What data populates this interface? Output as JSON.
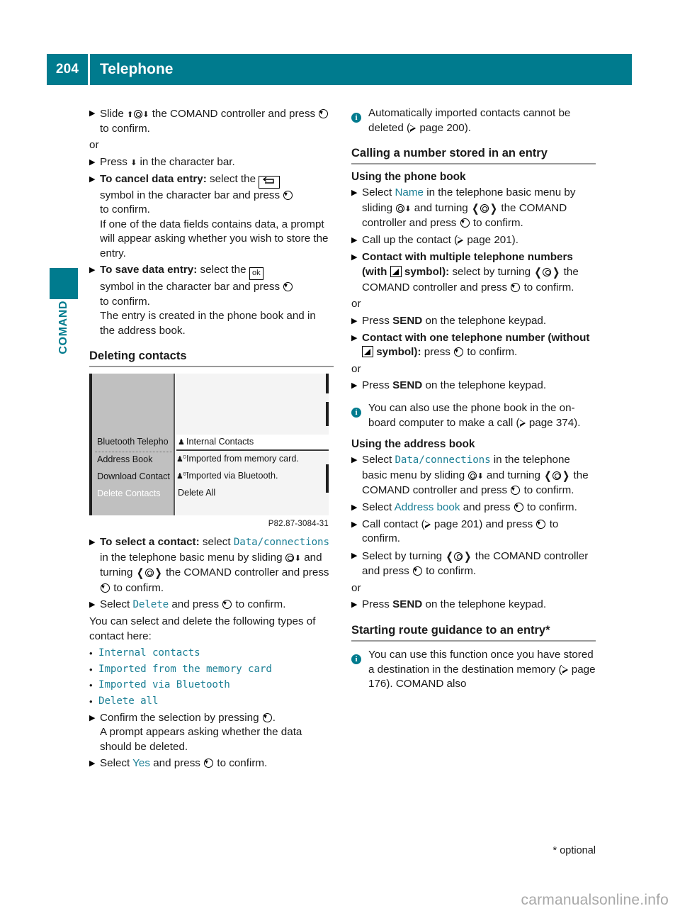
{
  "header": {
    "page_number": "204",
    "title": "Telephone"
  },
  "sidebar": {
    "tab_label": "COMAND"
  },
  "left_column": {
    "steps": [
      {
        "id": "slide-confirm",
        "parts": [
          "Slide ",
          "⬆◎⬇",
          " the COMAND controller and press ",
          "◎",
          " to confirm."
        ],
        "text": "Slide the COMAND controller and press to confirm."
      }
    ],
    "step1_pre": "Slide",
    "step1_mid": "the COMAND controller and",
    "step1_end": "press",
    "step1_tail": "to confirm.",
    "or_1": "or",
    "step2_pre": "Press",
    "step2_post": "in the character bar.",
    "step3_bold": "To cancel data entry:",
    "step3_a": "select the",
    "step3_b": "symbol in the character bar and press",
    "step3_c": "to confirm.",
    "step3_note": "If one of the data fields contains data, a prompt will appear asking whether you wish to store the entry.",
    "step4_bold": "To save data entry:",
    "step4_a": "select the",
    "step4_ok": "ok",
    "step4_b": "symbol in the character bar and press",
    "step4_c": "to confirm.",
    "step4_note": "The entry is created in the phone book and in the address book.",
    "heading_deleting": "Deleting contacts",
    "figure": {
      "caption": "P82.87-3084-31",
      "left_menu": [
        "Bluetooth Telepho",
        "Address Book",
        "Download Contact",
        "Delete Contacts"
      ],
      "left_menu_selected": "Delete Contacts",
      "right_menu": [
        {
          "label": "Internal Contacts",
          "icon": "contact-icon"
        },
        {
          "label": "Imported from memory card.",
          "icon": "contact-sd-icon"
        },
        {
          "label": "Imported via Bluetooth.",
          "icon": "contact-bt-icon"
        },
        {
          "label": "Delete All",
          "icon": ""
        }
      ]
    },
    "step5_bold": "To select a contact:",
    "step5_a": "select",
    "step5_mono": "Data/connections",
    "step5_b": "in the telephone basic menu by sliding",
    "step5_c": "and turning",
    "step5_d": "the COMAND controller and press",
    "step5_e": "to confirm.",
    "step6_a": "Select",
    "step6_mono": "Delete",
    "step6_b": "and press",
    "step6_c": "to confirm.",
    "para_types": "You can select and delete the following types of contact here:",
    "contact_types": [
      "Internal contacts",
      "Imported from the memory card",
      "Imported via Bluetooth",
      "Delete all"
    ],
    "step7_a": "Confirm the selection by pressing",
    "step7_b": ".",
    "step7_note": "A prompt appears asking whether the data should be deleted.",
    "step8_a": "Select",
    "step8_mono": "Yes",
    "step8_b": "and press",
    "step8_c": "to confirm."
  },
  "right_column": {
    "note1_a": "Automatically imported contacts cannot be deleted (",
    "note1_page": "page 200",
    "note1_b": ").",
    "heading_calling": "Calling a number stored in an entry",
    "subheading_phonebook": "Using the phone book",
    "r1_a": "Select",
    "r1_mono": "Name",
    "r1_b": "in the telephone basic menu by sliding",
    "r1_c": "and turning",
    "r1_d": "the COMAND controller and press",
    "r1_e": "to confirm.",
    "r2_a": "Call up the contact (",
    "r2_page": "page 201",
    "r2_b": ").",
    "r3_bold_a": "Contact with multiple telephone numbers (with",
    "r3_bold_b": "symbol):",
    "r3_a": "select by turning",
    "r3_b": "the COMAND controller and press",
    "r3_c": "to confirm.",
    "or_2": "or",
    "r4_a": "Press",
    "r4_bold": "SEND",
    "r4_b": "on the telephone keypad.",
    "r5_bold_a": "Contact with one telephone number (without",
    "r5_bold_b": "symbol):",
    "r5_a": "press",
    "r5_b": "to confirm.",
    "or_3": "or",
    "r6_a": "Press",
    "r6_bold": "SEND",
    "r6_b": "on the telephone keypad.",
    "note2_a": "You can also use the phone book in the on-board computer to make a call (",
    "note2_page": "page 374",
    "note2_b": ").",
    "subheading_addressbook": "Using the address book",
    "r7_a": "Select",
    "r7_mono": "Data/connections",
    "r7_b": "in the telephone basic menu by sliding",
    "r7_c": "and",
    "r7_d": "turning",
    "r7_e": "the COMAND controller and press",
    "r7_f": "to confirm.",
    "r8_a": "Select",
    "r8_mono": "Address book",
    "r8_b": "and press",
    "r8_c": "to confirm.",
    "r9_a": "Call contact (",
    "r9_page": "page 201",
    "r9_b": ") and press",
    "r9_c": "to confirm.",
    "r10_a": "Select by turning",
    "r10_b": "the COMAND controller and press",
    "r10_c": "to confirm.",
    "or_4": "or",
    "r11_a": "Press",
    "r11_bold": "SEND",
    "r11_b": "on the telephone keypad.",
    "heading_route": "Starting route guidance to an entry",
    "heading_route_star": "*",
    "note3_a": "You can use this function once you have stored a destination in the destination memory (",
    "note3_page": "page 176",
    "note3_b": "). COMAND also"
  },
  "footer": {
    "optional_note": "* optional",
    "watermark": "carmanualsonline.info"
  },
  "colors": {
    "accent_teal": "#007b8e",
    "mono_teal": "#1b7f95",
    "rule_gray": "#9a9a9a",
    "watermark_gray": "#a8a8a8"
  }
}
